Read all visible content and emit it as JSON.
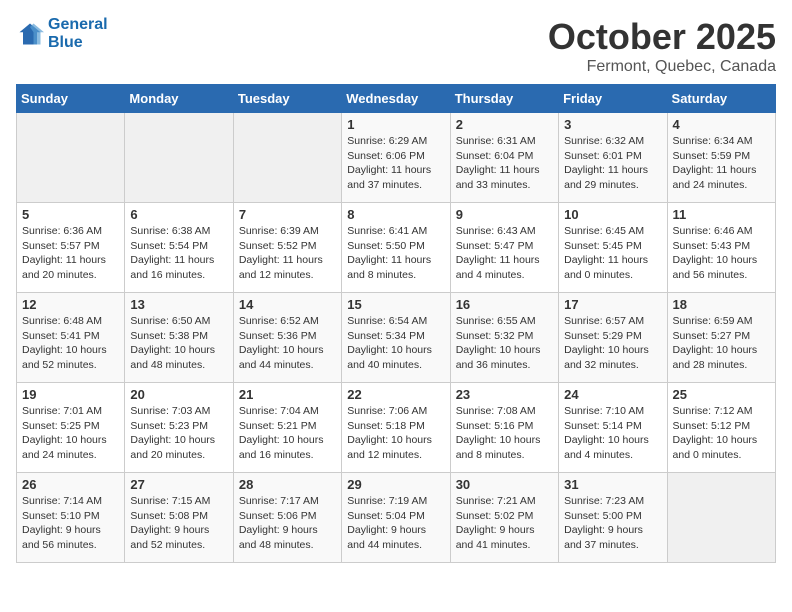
{
  "logo": {
    "line1": "General",
    "line2": "Blue"
  },
  "title": "October 2025",
  "subtitle": "Fermont, Quebec, Canada",
  "days_of_week": [
    "Sunday",
    "Monday",
    "Tuesday",
    "Wednesday",
    "Thursday",
    "Friday",
    "Saturday"
  ],
  "weeks": [
    [
      {
        "day": "",
        "info": ""
      },
      {
        "day": "",
        "info": ""
      },
      {
        "day": "",
        "info": ""
      },
      {
        "day": "1",
        "info": "Sunrise: 6:29 AM\nSunset: 6:06 PM\nDaylight: 11 hours\nand 37 minutes."
      },
      {
        "day": "2",
        "info": "Sunrise: 6:31 AM\nSunset: 6:04 PM\nDaylight: 11 hours\nand 33 minutes."
      },
      {
        "day": "3",
        "info": "Sunrise: 6:32 AM\nSunset: 6:01 PM\nDaylight: 11 hours\nand 29 minutes."
      },
      {
        "day": "4",
        "info": "Sunrise: 6:34 AM\nSunset: 5:59 PM\nDaylight: 11 hours\nand 24 minutes."
      }
    ],
    [
      {
        "day": "5",
        "info": "Sunrise: 6:36 AM\nSunset: 5:57 PM\nDaylight: 11 hours\nand 20 minutes."
      },
      {
        "day": "6",
        "info": "Sunrise: 6:38 AM\nSunset: 5:54 PM\nDaylight: 11 hours\nand 16 minutes."
      },
      {
        "day": "7",
        "info": "Sunrise: 6:39 AM\nSunset: 5:52 PM\nDaylight: 11 hours\nand 12 minutes."
      },
      {
        "day": "8",
        "info": "Sunrise: 6:41 AM\nSunset: 5:50 PM\nDaylight: 11 hours\nand 8 minutes."
      },
      {
        "day": "9",
        "info": "Sunrise: 6:43 AM\nSunset: 5:47 PM\nDaylight: 11 hours\nand 4 minutes."
      },
      {
        "day": "10",
        "info": "Sunrise: 6:45 AM\nSunset: 5:45 PM\nDaylight: 11 hours\nand 0 minutes."
      },
      {
        "day": "11",
        "info": "Sunrise: 6:46 AM\nSunset: 5:43 PM\nDaylight: 10 hours\nand 56 minutes."
      }
    ],
    [
      {
        "day": "12",
        "info": "Sunrise: 6:48 AM\nSunset: 5:41 PM\nDaylight: 10 hours\nand 52 minutes."
      },
      {
        "day": "13",
        "info": "Sunrise: 6:50 AM\nSunset: 5:38 PM\nDaylight: 10 hours\nand 48 minutes."
      },
      {
        "day": "14",
        "info": "Sunrise: 6:52 AM\nSunset: 5:36 PM\nDaylight: 10 hours\nand 44 minutes."
      },
      {
        "day": "15",
        "info": "Sunrise: 6:54 AM\nSunset: 5:34 PM\nDaylight: 10 hours\nand 40 minutes."
      },
      {
        "day": "16",
        "info": "Sunrise: 6:55 AM\nSunset: 5:32 PM\nDaylight: 10 hours\nand 36 minutes."
      },
      {
        "day": "17",
        "info": "Sunrise: 6:57 AM\nSunset: 5:29 PM\nDaylight: 10 hours\nand 32 minutes."
      },
      {
        "day": "18",
        "info": "Sunrise: 6:59 AM\nSunset: 5:27 PM\nDaylight: 10 hours\nand 28 minutes."
      }
    ],
    [
      {
        "day": "19",
        "info": "Sunrise: 7:01 AM\nSunset: 5:25 PM\nDaylight: 10 hours\nand 24 minutes."
      },
      {
        "day": "20",
        "info": "Sunrise: 7:03 AM\nSunset: 5:23 PM\nDaylight: 10 hours\nand 20 minutes."
      },
      {
        "day": "21",
        "info": "Sunrise: 7:04 AM\nSunset: 5:21 PM\nDaylight: 10 hours\nand 16 minutes."
      },
      {
        "day": "22",
        "info": "Sunrise: 7:06 AM\nSunset: 5:18 PM\nDaylight: 10 hours\nand 12 minutes."
      },
      {
        "day": "23",
        "info": "Sunrise: 7:08 AM\nSunset: 5:16 PM\nDaylight: 10 hours\nand 8 minutes."
      },
      {
        "day": "24",
        "info": "Sunrise: 7:10 AM\nSunset: 5:14 PM\nDaylight: 10 hours\nand 4 minutes."
      },
      {
        "day": "25",
        "info": "Sunrise: 7:12 AM\nSunset: 5:12 PM\nDaylight: 10 hours\nand 0 minutes."
      }
    ],
    [
      {
        "day": "26",
        "info": "Sunrise: 7:14 AM\nSunset: 5:10 PM\nDaylight: 9 hours\nand 56 minutes."
      },
      {
        "day": "27",
        "info": "Sunrise: 7:15 AM\nSunset: 5:08 PM\nDaylight: 9 hours\nand 52 minutes."
      },
      {
        "day": "28",
        "info": "Sunrise: 7:17 AM\nSunset: 5:06 PM\nDaylight: 9 hours\nand 48 minutes."
      },
      {
        "day": "29",
        "info": "Sunrise: 7:19 AM\nSunset: 5:04 PM\nDaylight: 9 hours\nand 44 minutes."
      },
      {
        "day": "30",
        "info": "Sunrise: 7:21 AM\nSunset: 5:02 PM\nDaylight: 9 hours\nand 41 minutes."
      },
      {
        "day": "31",
        "info": "Sunrise: 7:23 AM\nSunset: 5:00 PM\nDaylight: 9 hours\nand 37 minutes."
      },
      {
        "day": "",
        "info": ""
      }
    ]
  ]
}
